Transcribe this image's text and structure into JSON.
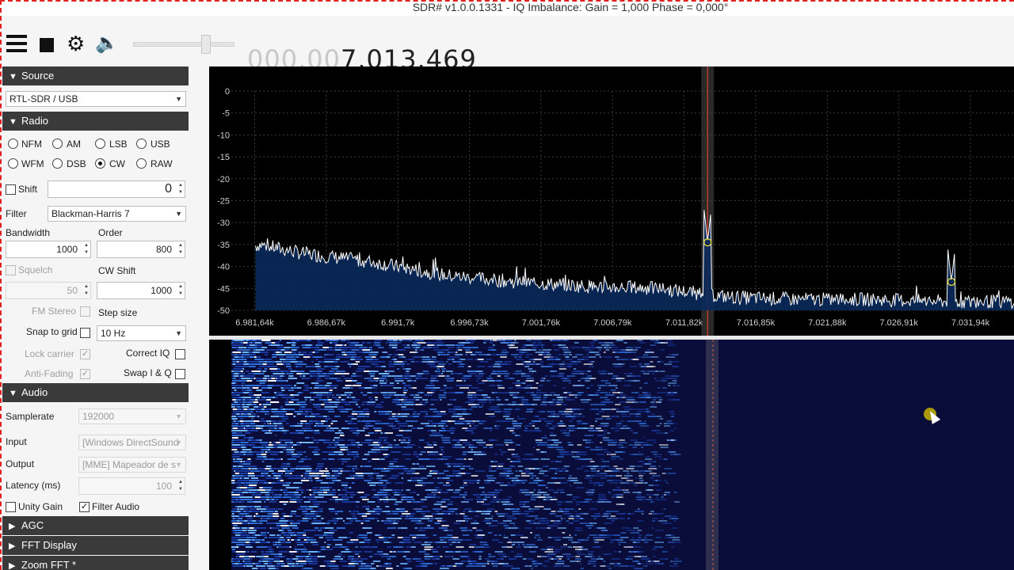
{
  "window": {
    "title": "SDR# v1.0.0.1331 - IQ Imbalance: Gain = 1,000 Phase = 0,000°"
  },
  "toolbar": {
    "menu_icon": "hamburger-menu-icon",
    "stop_icon": "stop-icon",
    "settings_icon": "gear-icon",
    "audio_icon": "speaker-icon",
    "volume_level": 0.74,
    "frequency_dim": "000.00",
    "frequency_bright": "7.013.469"
  },
  "source": {
    "header": "Source",
    "device": "RTL-SDR / USB"
  },
  "radio": {
    "header": "Radio",
    "modes": [
      {
        "label": "NFM",
        "selected": false
      },
      {
        "label": "AM",
        "selected": false
      },
      {
        "label": "LSB",
        "selected": false
      },
      {
        "label": "USB",
        "selected": false
      },
      {
        "label": "WFM",
        "selected": false
      },
      {
        "label": "DSB",
        "selected": false
      },
      {
        "label": "CW",
        "selected": true
      },
      {
        "label": "RAW",
        "selected": false
      }
    ],
    "shift_label": "Shift",
    "shift_value": "0",
    "filter_label": "Filter",
    "filter_value": "Blackman-Harris 7",
    "bandwidth_label": "Bandwidth",
    "bandwidth_value": "1000",
    "order_label": "Order",
    "order_value": "800",
    "squelch_label": "Squelch",
    "squelch_value": "50",
    "cwshift_label": "CW Shift",
    "cwshift_value": "1000",
    "fmstereo_label": "FM Stereo",
    "stepsize_label": "Step size",
    "snap_label": "Snap to grid",
    "step_value": "10 Hz",
    "lockcarrier_label": "Lock carrier",
    "correctiq_label": "Correct IQ",
    "antifading_label": "Anti-Fading",
    "swapiq_label": "Swap I & Q"
  },
  "audio": {
    "header": "Audio",
    "samplerate_label": "Samplerate",
    "samplerate_value": "192000",
    "input_label": "Input",
    "input_value": "[Windows DirectSound",
    "output_label": "Output",
    "output_value": "[MME] Mapeador de s",
    "latency_label": "Latency (ms)",
    "latency_value": "100",
    "unitygain_label": "Unity Gain",
    "filteraudio_label": "Filter Audio"
  },
  "collapsed_sections": [
    "AGC",
    "FFT Display",
    "Zoom FFT *"
  ],
  "chart_data": {
    "type": "line",
    "title": "",
    "xlabel": "",
    "ylabel": "",
    "x_ticks": [
      "6.981,64k",
      "6.986,67k",
      "6.991,7k",
      "6.996,73k",
      "7.001,76k",
      "7.006,79k",
      "7.011,82k",
      "7.016,85k",
      "7.021,88k",
      "7.026,91k",
      "7.031,94k"
    ],
    "y_ticks": [
      "0",
      "-5",
      "-10",
      "-15",
      "-20",
      "-25",
      "-30",
      "-35",
      "-40",
      "-45",
      "-50"
    ],
    "ylim": [
      -50,
      0
    ],
    "x_khz_range": [
      6980.0,
      7035.0
    ],
    "tuned_khz": 7013.469,
    "peaks": [
      {
        "x_khz": 7013.469,
        "db": -34.5
      },
      {
        "x_khz": 7030.6,
        "db": -43.5
      }
    ],
    "noise_floor_db": {
      "x_khz": [
        6980,
        6982,
        6985,
        6990,
        6995,
        7000,
        7005,
        7010,
        7015,
        7020,
        7025,
        7030,
        7035
      ],
      "db": [
        -37,
        -35,
        -37,
        -39,
        -42,
        -43.5,
        -44.5,
        -45,
        -47,
        -47.5,
        -47.5,
        -48,
        -48
      ]
    },
    "grid": true,
    "colors": {
      "trace": "#ffffff",
      "fill": "#0a2a5c",
      "marker": "#e8e030",
      "tuned_line": "#d04030",
      "grid": "#3a3a3a"
    }
  }
}
